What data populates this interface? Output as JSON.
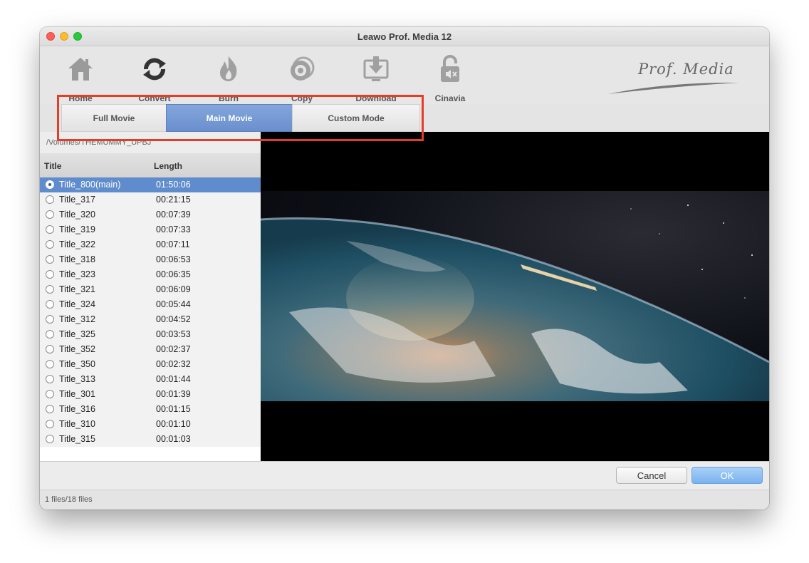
{
  "window": {
    "title": "Leawo Prof. Media 12"
  },
  "toolbar": {
    "items": [
      {
        "label": "Home",
        "icon": "home-icon"
      },
      {
        "label": "Convert",
        "icon": "convert-icon"
      },
      {
        "label": "Burn",
        "icon": "flame-icon"
      },
      {
        "label": "Copy",
        "icon": "disc-icon"
      },
      {
        "label": "Download",
        "icon": "download-icon"
      },
      {
        "label": "Cinavia",
        "icon": "unlock-icon"
      }
    ],
    "logo_text": "Prof. Media"
  },
  "modes": {
    "tabs": [
      {
        "label": "Full Movie",
        "active": false
      },
      {
        "label": "Main Movie",
        "active": true
      },
      {
        "label": "Custom Mode",
        "active": false
      }
    ]
  },
  "source": {
    "path": "/Volumes/THEMUMMY_UPBJ"
  },
  "titles": {
    "headers": {
      "title": "Title",
      "length": "Length"
    },
    "rows": [
      {
        "name": "Title_800(main)",
        "length": "01:50:06",
        "selected": true
      },
      {
        "name": "Title_317",
        "length": "00:21:15"
      },
      {
        "name": "Title_320",
        "length": "00:07:39"
      },
      {
        "name": "Title_319",
        "length": "00:07:33"
      },
      {
        "name": "Title_322",
        "length": "00:07:11"
      },
      {
        "name": "Title_318",
        "length": "00:06:53"
      },
      {
        "name": "Title_323",
        "length": "00:06:35"
      },
      {
        "name": "Title_321",
        "length": "00:06:09"
      },
      {
        "name": "Title_324",
        "length": "00:05:44"
      },
      {
        "name": "Title_312",
        "length": "00:04:52"
      },
      {
        "name": "Title_325",
        "length": "00:03:53"
      },
      {
        "name": "Title_352",
        "length": "00:02:37"
      },
      {
        "name": "Title_350",
        "length": "00:02:32"
      },
      {
        "name": "Title_313",
        "length": "00:01:44"
      },
      {
        "name": "Title_301",
        "length": "00:01:39"
      },
      {
        "name": "Title_316",
        "length": "00:01:15"
      },
      {
        "name": "Title_310",
        "length": "00:01:10"
      },
      {
        "name": "Title_315",
        "length": "00:01:03"
      }
    ]
  },
  "buttons": {
    "cancel": "Cancel",
    "ok": "OK"
  },
  "status": {
    "text": "1 files/18 files"
  },
  "colors": {
    "accent": "#6a8fcd",
    "selection": "#5f8ccc",
    "highlight": "#e63c28"
  }
}
